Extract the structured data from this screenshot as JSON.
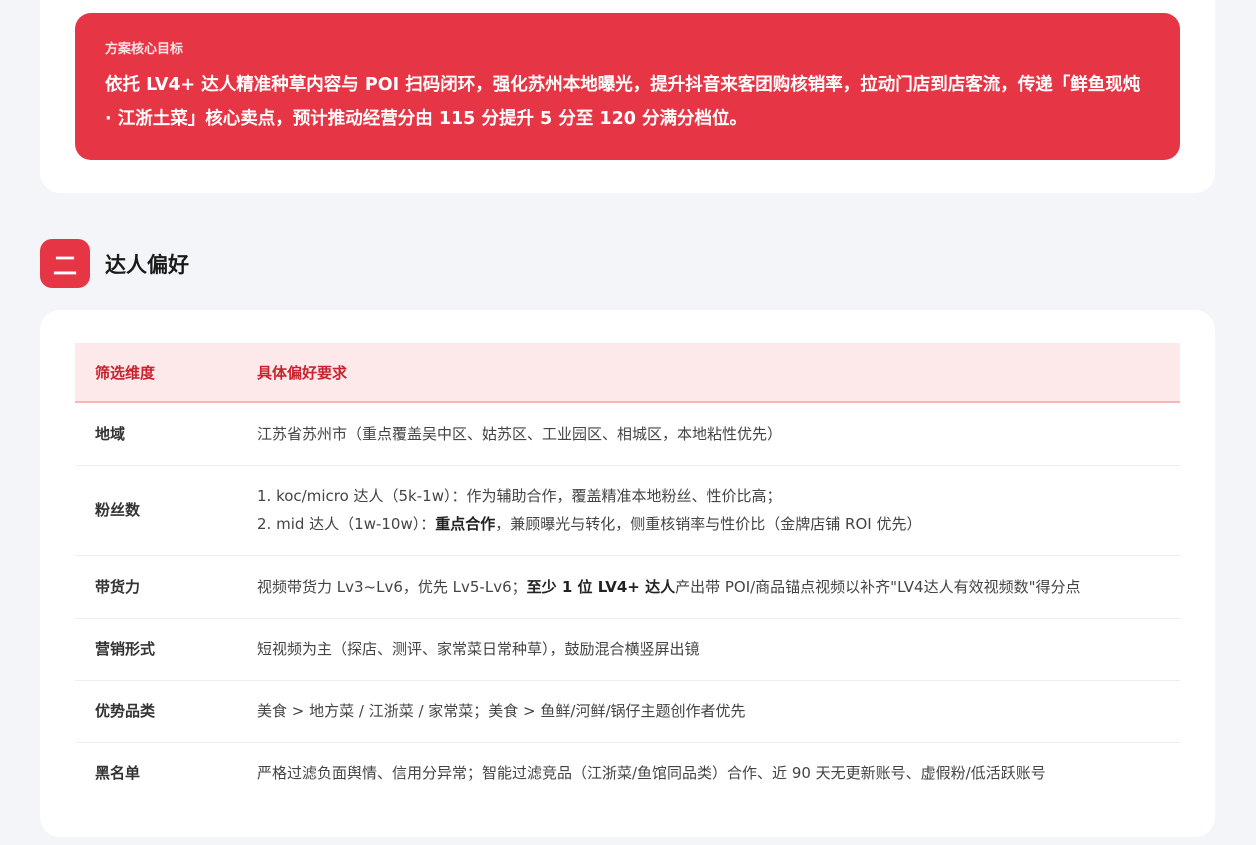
{
  "goal": {
    "label": "方案核心目标",
    "text": "依托 LV4+ 达人精准种草内容与 POI 扫码闭环，强化苏州本地曝光，提升抖音来客团购核销率，拉动门店到店客流，传递「鲜鱼现炖 · 江浙土菜」核心卖点，预计推动经营分由 115 分提升 5 分至 120 分满分档位。"
  },
  "section": {
    "number": "二",
    "title": "达人偏好"
  },
  "table": {
    "headers": [
      "筛选维度",
      "具体偏好要求"
    ],
    "rows": [
      {
        "dim": "地域",
        "lines": [
          {
            "pre": "江苏省苏州市（重点覆盖吴中区、姑苏区、工业园区、相城区，本地粘性优先）"
          }
        ]
      },
      {
        "dim": "粉丝数",
        "lines": [
          {
            "pre": "1. koc/micro 达人（5k-1w）：作为辅助合作，覆盖精准本地粉丝、性价比高；"
          },
          {
            "pre": "2. mid 达人（1w-10w）：",
            "bold": "重点合作",
            "post": "，兼顾曝光与转化，侧重核销率与性价比（金牌店铺 ROI 优先）"
          }
        ]
      },
      {
        "dim": "带货力",
        "lines": [
          {
            "pre": "视频带货力 Lv3~Lv6，优先 Lv5-Lv6；",
            "bold": "至少 1 位 LV4+ 达人",
            "post": "产出带 POI/商品锚点视频以补齐\"LV4达人有效视频数\"得分点"
          }
        ]
      },
      {
        "dim": "营销形式",
        "lines": [
          {
            "pre": "短视频为主（探店、测评、家常菜日常种草），鼓励混合横竖屏出镜"
          }
        ]
      },
      {
        "dim": "优势品类",
        "lines": [
          {
            "pre": "美食 > 地方菜 / 江浙菜 / 家常菜；美食 > 鱼鲜/河鲜/锅仔主题创作者优先"
          }
        ]
      },
      {
        "dim": "黑名单",
        "lines": [
          {
            "pre": "严格过滤负面舆情、信用分异常；智能过滤竞品（江浙菜/鱼馆同品类）合作、近 90 天无更新账号、虚假粉/低活跃账号"
          }
        ]
      }
    ]
  }
}
